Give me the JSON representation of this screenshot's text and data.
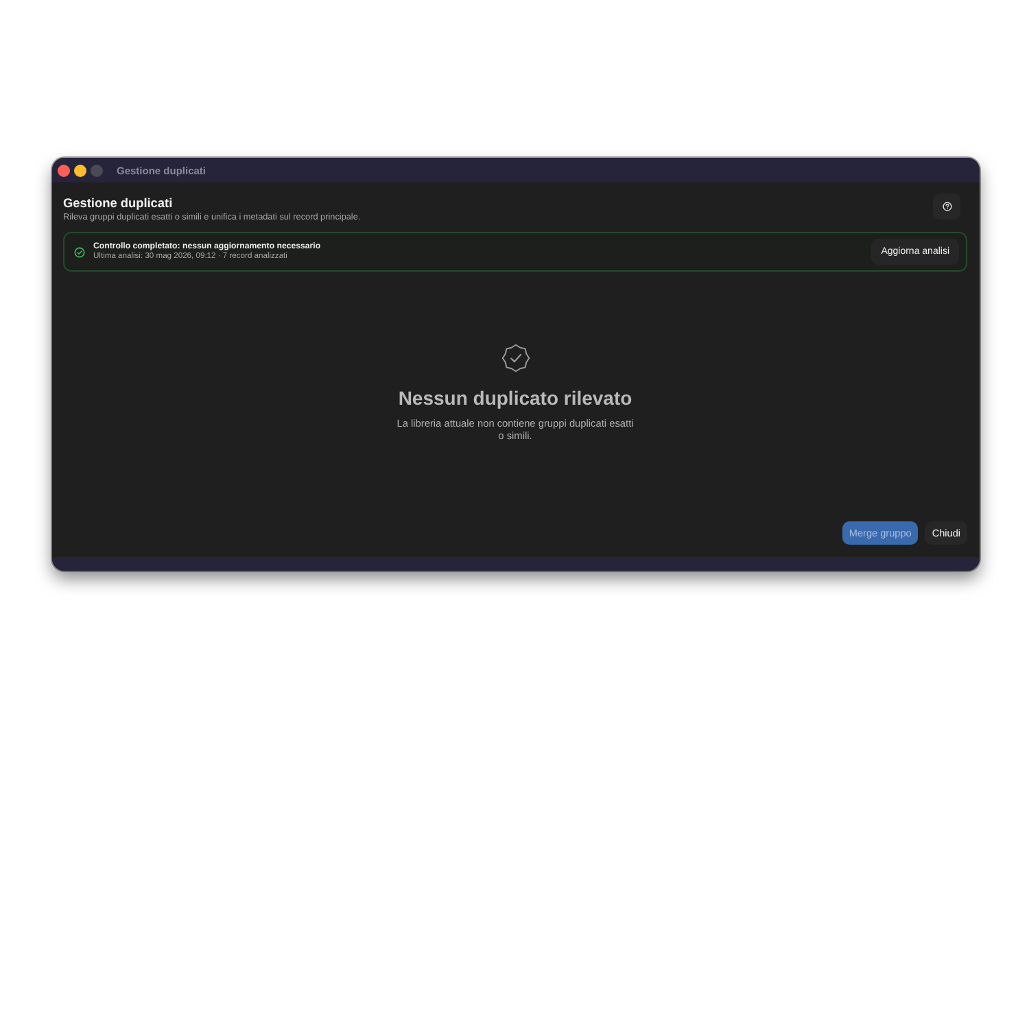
{
  "window": {
    "title": "Gestione duplicati"
  },
  "header": {
    "title": "Gestione duplicati",
    "subtitle": "Rileva gruppi duplicati esatti o simili e unifica i metadati sul record principale."
  },
  "status_banner": {
    "title": "Controllo completato: nessun aggiornamento necessario",
    "detail": "Ultima analisi: 30 mag 2026, 09:12 · 7 record analizzati",
    "button": "Aggiorna analisi"
  },
  "empty_state": {
    "title": "Nessun duplicato rilevato",
    "description": "La libreria attuale non contiene gruppi duplicati esatti o simili."
  },
  "footer": {
    "buttons": [
      {
        "label": "Merge gruppo",
        "kind": "primary",
        "disabled": true
      },
      {
        "label": "Chiudi",
        "kind": "secondary",
        "disabled": false
      }
    ]
  }
}
